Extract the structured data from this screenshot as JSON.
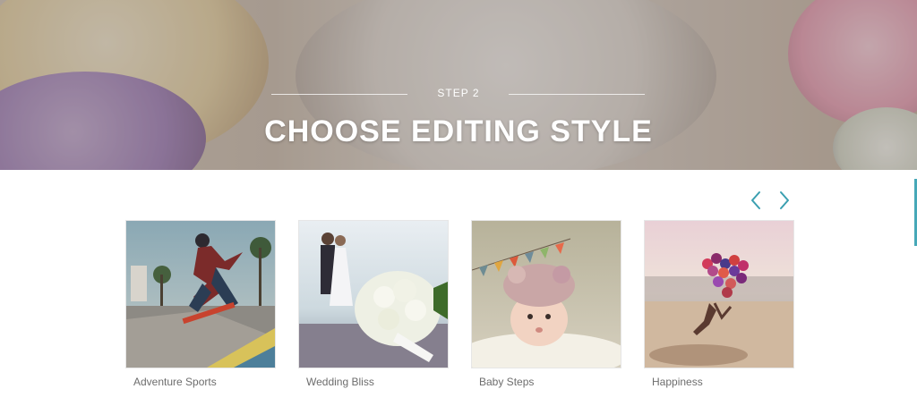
{
  "hero": {
    "step": "STEP 2",
    "title": "CHOOSE EDITING STYLE"
  },
  "carousel": {
    "prev_icon": "chevron-left-icon",
    "next_icon": "chevron-right-icon",
    "accent_color": "#3a9fb0"
  },
  "styles": [
    {
      "label": "Adventure Sports"
    },
    {
      "label": "Wedding Bliss"
    },
    {
      "label": "Baby Steps"
    },
    {
      "label": "Happiness"
    }
  ]
}
